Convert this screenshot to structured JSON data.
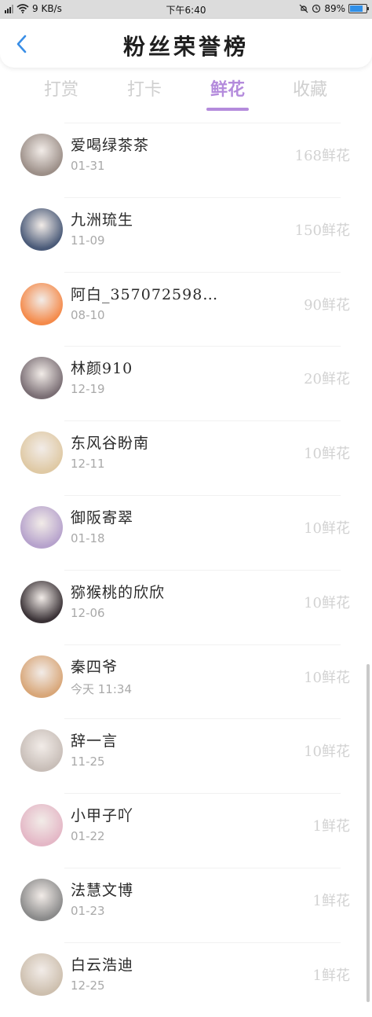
{
  "status_bar": {
    "network_speed": "9 KB/s",
    "time": "下午6:40",
    "battery": "89%",
    "battery_level": 0.89
  },
  "header": {
    "title": "粉丝荣誉榜",
    "back_icon": "chevron-left-icon"
  },
  "tabs": [
    {
      "label": "打赏",
      "active": false
    },
    {
      "label": "打卡",
      "active": false
    },
    {
      "label": "鲜花",
      "active": true
    },
    {
      "label": "收藏",
      "active": false
    }
  ],
  "accent_color": "#b48bdc",
  "fans": [
    {
      "name": "爱喝绿茶茶",
      "date": "01-31",
      "amount": "168鲜花",
      "avatar_color": "#9c8f88"
    },
    {
      "name": "九洲琉生",
      "date": "11-09",
      "amount": "150鲜花",
      "avatar_color": "#4a5a78"
    },
    {
      "name": "阿白_357072598…",
      "date": "08-10",
      "amount": "90鲜花",
      "avatar_color": "#f48a4a"
    },
    {
      "name": "林颜910",
      "date": "12-19",
      "amount": "20鲜花",
      "avatar_color": "#7a6e74"
    },
    {
      "name": "东风谷盼南",
      "date": "12-11",
      "amount": "10鲜花",
      "avatar_color": "#dfc9a4"
    },
    {
      "name": "御阪寄翠",
      "date": "01-18",
      "amount": "10鲜花",
      "avatar_color": "#b6a2cc"
    },
    {
      "name": "猕猴桃的欣欣",
      "date": "12-06",
      "amount": "10鲜花",
      "avatar_color": "#3a3236"
    },
    {
      "name": "秦四爷",
      "date": "今天 11:34",
      "amount": "10鲜花",
      "avatar_color": "#d8a678"
    },
    {
      "name": "辞一言",
      "date": "11-25",
      "amount": "10鲜花",
      "avatar_color": "#c8beb8"
    },
    {
      "name": "小甲子吖",
      "date": "01-22",
      "amount": "1鲜花",
      "avatar_color": "#e4b7c6"
    },
    {
      "name": "法慧文博",
      "date": "01-23",
      "amount": "1鲜花",
      "avatar_color": "#8a8a8a"
    },
    {
      "name": "白云浩迪",
      "date": "12-25",
      "amount": "1鲜花",
      "avatar_color": "#cdbfae"
    }
  ]
}
